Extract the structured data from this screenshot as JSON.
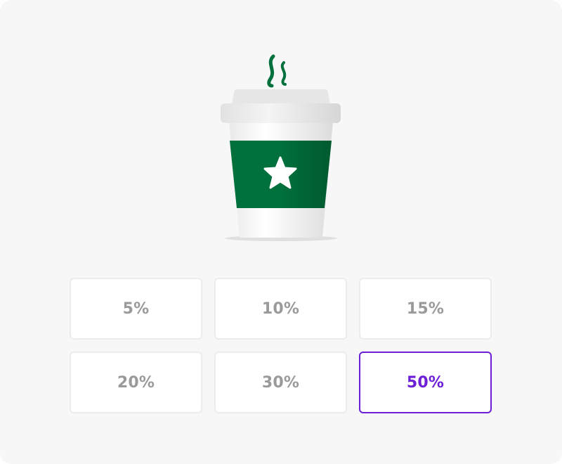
{
  "illustration": {
    "icon": "coffee-cup-icon",
    "sleeve_color": "#00703c",
    "star_icon": "star-icon",
    "steam_color": "#00703c"
  },
  "tip_options": [
    {
      "label": "5%",
      "selected": false
    },
    {
      "label": "10%",
      "selected": false
    },
    {
      "label": "15%",
      "selected": false
    },
    {
      "label": "20%",
      "selected": false
    },
    {
      "label": "30%",
      "selected": false
    },
    {
      "label": "50%",
      "selected": true
    }
  ],
  "colors": {
    "accent": "#6d1fd6",
    "text_muted": "#9a9a9a",
    "background": "#f7f7f7"
  }
}
